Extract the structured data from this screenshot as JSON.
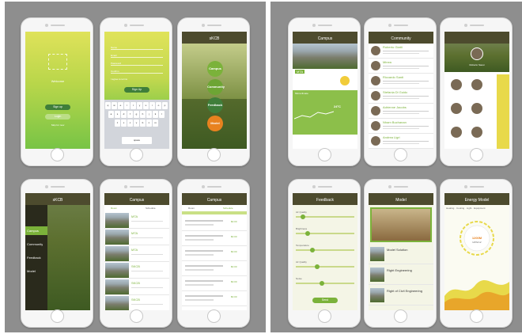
{
  "phones": {
    "welcome": {
      "line1": "Welcome",
      "login": "Sign up",
      "login2": "Login",
      "guest": "Skip for now"
    },
    "signup": {
      "fields": [
        "Name",
        "Email",
        "Password",
        "Confirm"
      ],
      "agree": "I agree to terms",
      "button": "Sign Up",
      "keys": [
        "q",
        "w",
        "e",
        "r",
        "t",
        "y",
        "u",
        "i",
        "o",
        "p",
        "a",
        "s",
        "d",
        "f",
        "g",
        "h",
        "j",
        "k",
        "l",
        "z",
        "x",
        "c",
        "v",
        "b",
        "n",
        "m"
      ],
      "space": "space"
    },
    "menu_home": {
      "title": "sKCB",
      "items": [
        "Campus",
        "Community",
        "Feedback",
        "Model"
      ]
    },
    "side_menu": {
      "title": "sKCB",
      "items": [
        "Campus",
        "Community",
        "Feedback",
        "Model"
      ]
    },
    "campus_list": {
      "title": "Campus",
      "tabs": [
        "Room",
        "Schedule"
      ],
      "rooms": [
        "MTA",
        "MTA",
        "MTA",
        "SKCB",
        "SKCB",
        "SKCB"
      ]
    },
    "campus_schedule": {
      "title": "Campus",
      "tabs": [
        "Room",
        "Schedule"
      ],
      "price": "$0.00"
    },
    "campus_detail": {
      "title": "Campus",
      "name": "MTA",
      "temp": "24°C",
      "section": "Microclimate"
    },
    "community": {
      "title": "Community",
      "names": [
        "Roberto Giatti",
        "Minea",
        "Riccardo Santi",
        "Stefania Di Guido",
        "Adrienne Jacobs",
        "Nham Buchanan",
        "Andrea Ligri"
      ]
    },
    "profile": {
      "name": "Roberto Sausi"
    },
    "feedback": {
      "title": "Feedback",
      "labels": [
        "Air Quality",
        "Brightness",
        "Temperature",
        "Air Quality",
        "Noise"
      ],
      "button": "Send"
    },
    "model": {
      "title": "Model",
      "items": [
        "Model Solution",
        "Right Engineering",
        "Right of Civil Engineering"
      ]
    },
    "energy": {
      "title": "Energy Model",
      "legend": [
        "Heating",
        "Cooling",
        "Light",
        "Equipment"
      ],
      "value": "1200M",
      "unit": "kWh/m2"
    }
  },
  "colors": {
    "green": "#7bb23a",
    "dark": "#4d4b2e",
    "orange": "#e8821f",
    "yellow": "#e8d94a"
  }
}
